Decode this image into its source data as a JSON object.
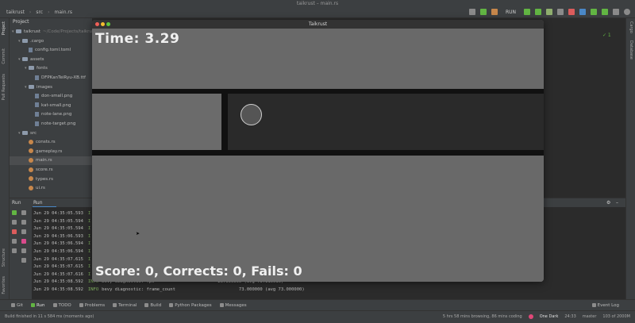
{
  "ide": {
    "window_title": "taikrust – main.rs",
    "breadcrumbs": [
      "taikrust",
      "src",
      "main.rs"
    ],
    "run_config": "RUN",
    "project_header": "Project",
    "left_tabs": [
      "Project",
      "Commit",
      "Pull Requests",
      "Structure",
      "Favorites"
    ],
    "right_tabs": [
      "Cargo",
      "Database"
    ],
    "tree": [
      {
        "label": "taikrust",
        "extra": "~/Code/Projects/taikrust",
        "kind": "folder",
        "depth": 0
      },
      {
        "label": ".cargo",
        "kind": "folder",
        "depth": 1
      },
      {
        "label": "config.toml.toml",
        "kind": "file",
        "depth": 2
      },
      {
        "label": "assets",
        "kind": "folder",
        "depth": 1
      },
      {
        "label": "fonts",
        "kind": "folder",
        "depth": 2
      },
      {
        "label": "DFPKanTeiRyu-XB.ttf",
        "kind": "file",
        "depth": 3
      },
      {
        "label": "images",
        "kind": "folder",
        "depth": 2
      },
      {
        "label": "don-small.png",
        "kind": "file",
        "depth": 3
      },
      {
        "label": "kat-small.png",
        "kind": "file",
        "depth": 3
      },
      {
        "label": "note-lane.png",
        "kind": "file",
        "depth": 3
      },
      {
        "label": "note-target.png",
        "kind": "file",
        "depth": 3
      },
      {
        "label": "src",
        "kind": "folder",
        "depth": 1
      },
      {
        "label": "consts.rs",
        "kind": "rs",
        "depth": 2
      },
      {
        "label": "gameplay.rs",
        "kind": "rs",
        "depth": 2
      },
      {
        "label": "main.rs",
        "kind": "rs",
        "depth": 2
      },
      {
        "label": "score.rs",
        "kind": "rs",
        "depth": 2
      },
      {
        "label": "types.rs",
        "kind": "rs",
        "depth": 2
      },
      {
        "label": "ui.rs",
        "kind": "rs",
        "depth": 2
      }
    ],
    "run_panel": {
      "label_run": "Run",
      "label_tab": "Run"
    },
    "logs": [
      {
        "ts": "Jun 29 04:35:05.593",
        "lv": "I"
      },
      {
        "ts": "Jun 29 04:35:05.594",
        "lv": "I"
      },
      {
        "ts": "Jun 29 04:35:05.594",
        "lv": "I"
      },
      {
        "ts": "Jun 29 04:35:06.593",
        "lv": "I"
      },
      {
        "ts": "Jun 29 04:35:06.594",
        "lv": "I"
      },
      {
        "ts": "Jun 29 04:35:06.594",
        "lv": "I"
      },
      {
        "ts": "Jun 29 04:35:07.615",
        "lv": "I"
      },
      {
        "ts": "Jun 29 04:35:07.615",
        "lv": "I"
      },
      {
        "ts": "Jun 29 04:35:07.616",
        "lv": "I"
      },
      {
        "ts": "Jun 29 04:35:08.592",
        "lv": "INFO",
        "msg": "bevy diagnostic: fps",
        "val": "25.000000  (avg 73.116616)"
      },
      {
        "ts": "Jun 29 04:35:08.592",
        "lv": "INFO",
        "msg": "bevy diagnostic: frame_count",
        "val": "73.000000  (avg 73.000000)"
      }
    ],
    "bottom_tabs": [
      "Git",
      "Run",
      "TODO",
      "Problems",
      "Terminal",
      "Build",
      "Python Packages",
      "Messages"
    ],
    "bottom_right": "Event Log",
    "status_left": "Build finished in 11 s 584 ms (moments ago)",
    "status_right": [
      "5 hrs 58 mins browsing, 86 mins coding",
      "One Dark",
      "24:33",
      "master",
      "103 of 2000M"
    ],
    "window_bar": {
      "title": "Taikrust"
    }
  },
  "game": {
    "time_label": "Time: 3.29",
    "score_label": "Score: 0, Corrects: 0, Fails: 0"
  }
}
